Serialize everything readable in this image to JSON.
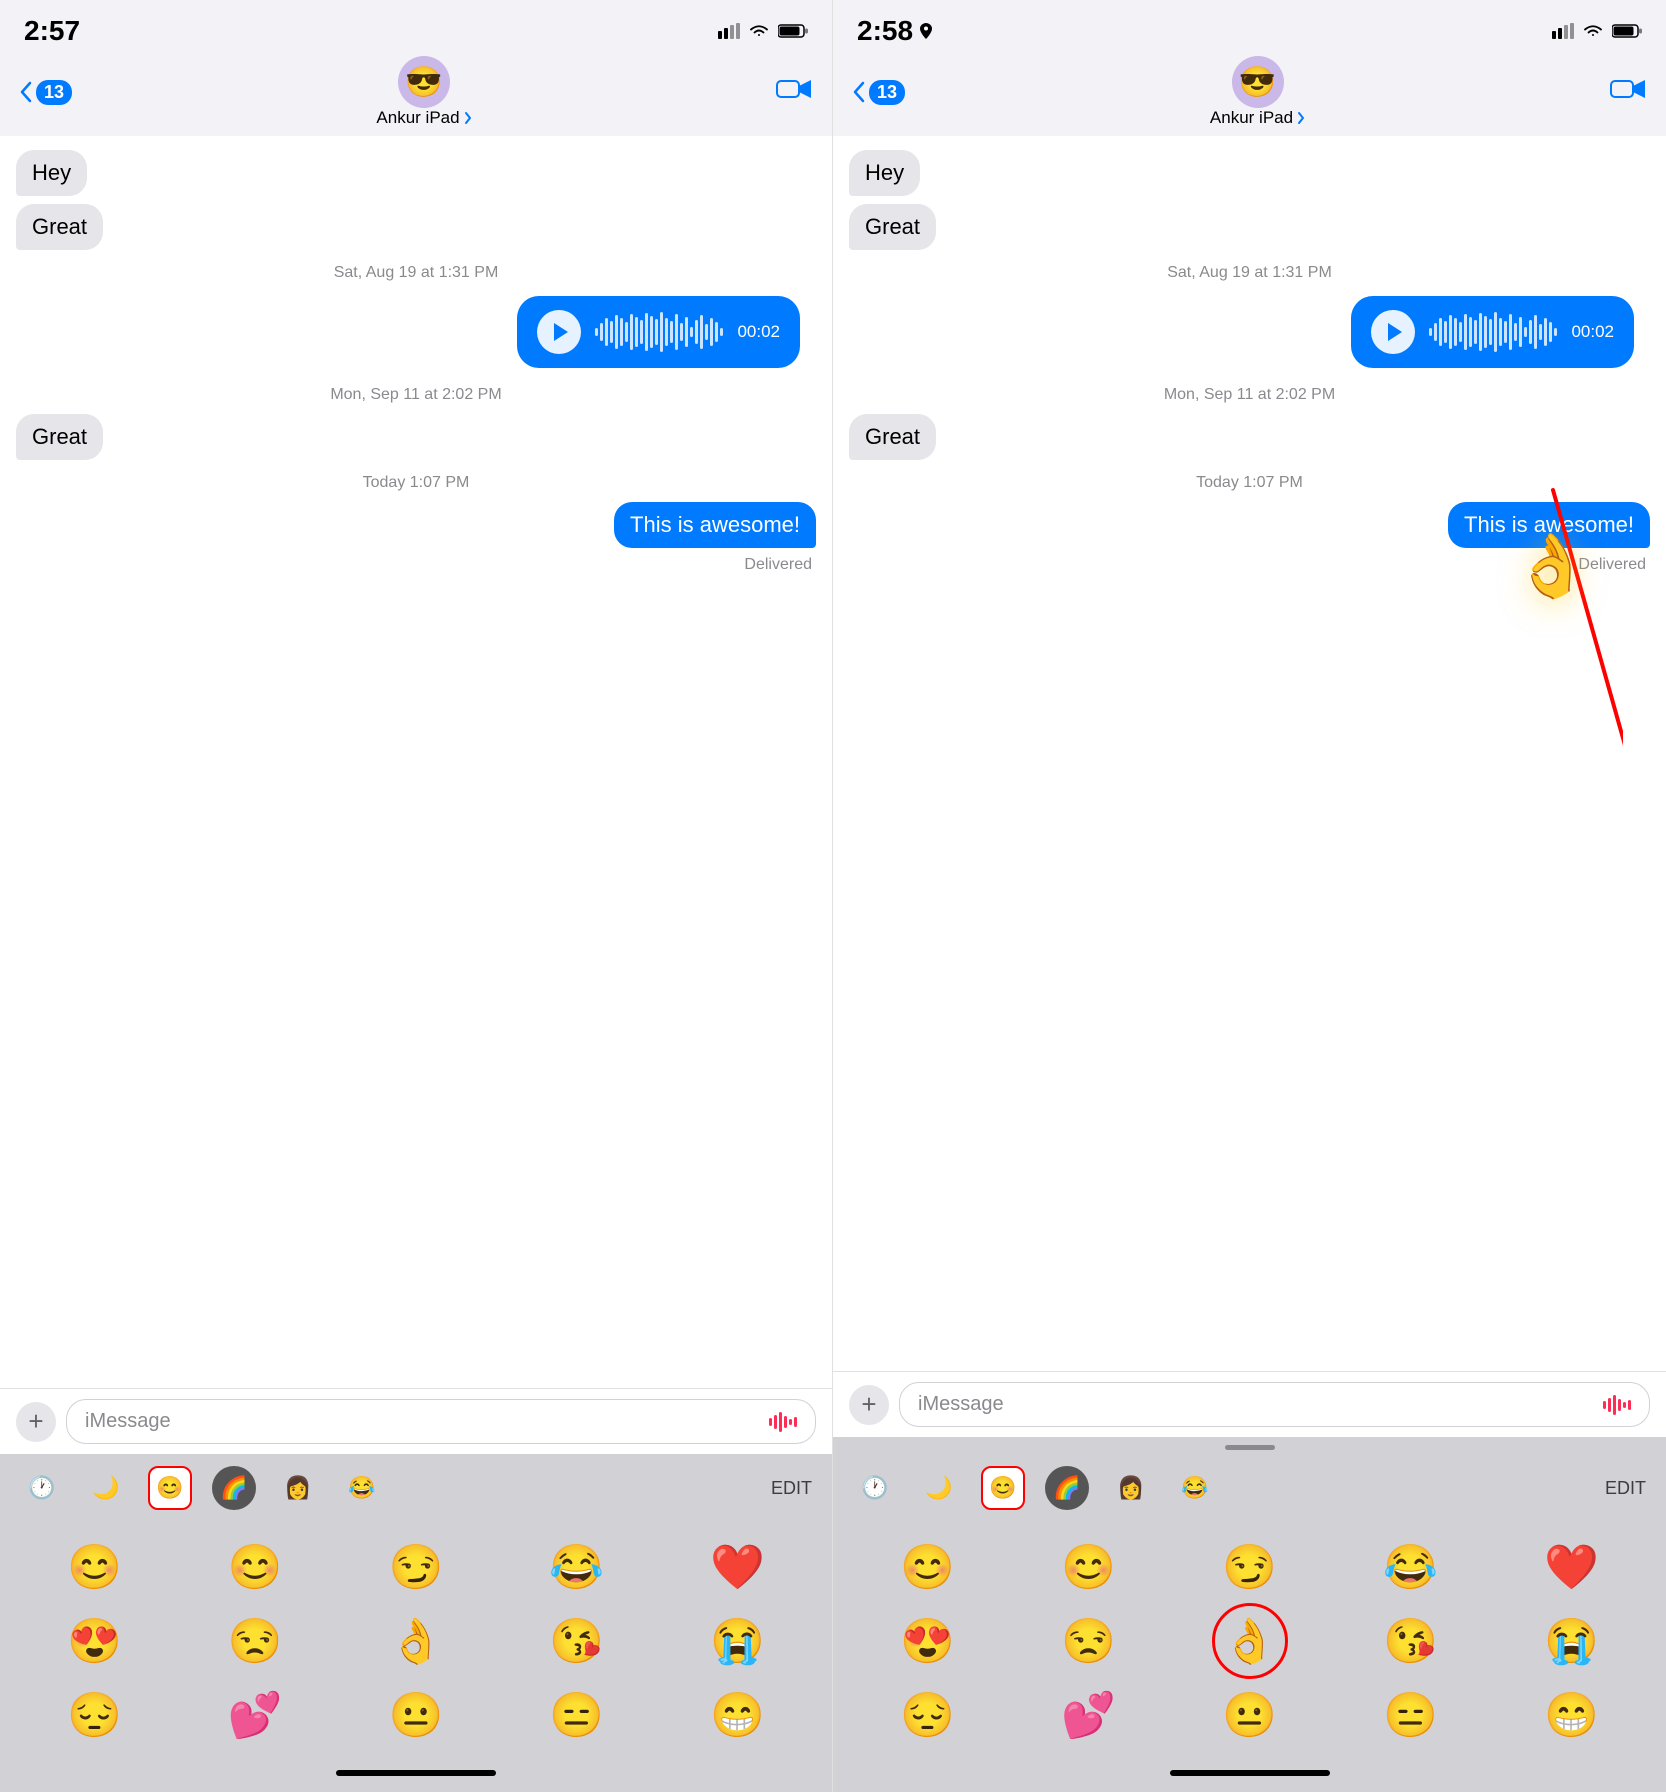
{
  "left_panel": {
    "status": {
      "time": "2:57",
      "signal": "▪▪▪",
      "wifi": "wifi",
      "battery": "battery"
    },
    "nav": {
      "back_count": "13",
      "contact_name": "Ankur iPad",
      "chevron": "›",
      "avatar_emoji": "😎"
    },
    "messages": [
      {
        "type": "left",
        "text": "Hey"
      },
      {
        "type": "left",
        "text": "Great"
      },
      {
        "type": "timestamp",
        "text": "Sat, Aug 19 at 1:31 PM"
      },
      {
        "type": "audio",
        "duration": "00:02"
      },
      {
        "type": "timestamp",
        "text": "Mon, Sep 11 at 2:02 PM"
      },
      {
        "type": "left",
        "text": "Great"
      },
      {
        "type": "timestamp",
        "text": "Today 1:07 PM"
      },
      {
        "type": "right",
        "text": "This is awesome!"
      },
      {
        "type": "delivered",
        "text": "Delivered"
      }
    ],
    "input": {
      "placeholder": "iMessage",
      "plus": "+",
      "waveform": "📊"
    },
    "emoji_tabs": [
      {
        "icon": "🕐",
        "selected": false,
        "label": "recent"
      },
      {
        "icon": "🌙",
        "selected": false,
        "label": "crescent"
      },
      {
        "icon": "😊",
        "selected": true,
        "label": "smiley"
      },
      {
        "icon": "🌈",
        "selected": false,
        "dark": true,
        "label": "colorball"
      },
      {
        "icon": "👩",
        "selected": false,
        "label": "person"
      },
      {
        "icon": "😂",
        "selected": false,
        "label": "laughcry"
      },
      {
        "label_text": "EDIT"
      }
    ],
    "emoji_rows": [
      [
        "😊",
        "😊",
        "😏",
        "😂",
        "❤️"
      ],
      [
        "😍",
        "😒",
        "👌",
        "😘",
        "😭"
      ],
      [
        "😔",
        "💕",
        "😐",
        "😑",
        "😁"
      ]
    ]
  },
  "right_panel": {
    "status": {
      "time": "2:58",
      "location": "▶",
      "signal": "▪▪▪",
      "wifi": "wifi",
      "battery": "battery"
    },
    "nav": {
      "back_count": "13",
      "contact_name": "Ankur iPad",
      "chevron": "›",
      "avatar_emoji": "😎"
    },
    "messages": [
      {
        "type": "left",
        "text": "Hey"
      },
      {
        "type": "left",
        "text": "Great"
      },
      {
        "type": "timestamp",
        "text": "Sat, Aug 19 at 1:31 PM"
      },
      {
        "type": "audio",
        "duration": "00:02"
      },
      {
        "type": "timestamp",
        "text": "Mon, Sep 11 at 2:02 PM"
      },
      {
        "type": "left",
        "text": "Great"
      },
      {
        "type": "timestamp",
        "text": "Today 1:07 PM"
      },
      {
        "type": "right",
        "text": "This is awesome!"
      },
      {
        "type": "delivered",
        "text": "Delivered"
      }
    ],
    "input": {
      "placeholder": "iMessage",
      "plus": "+",
      "waveform": "📊"
    },
    "annotation": {
      "floating_emoji": "👌",
      "arrow_color": "#ff0000",
      "circle_target": "ok-emoji"
    },
    "emoji_tabs": [
      {
        "icon": "🕐",
        "selected": false,
        "label": "recent"
      },
      {
        "icon": "🌙",
        "selected": false,
        "label": "crescent"
      },
      {
        "icon": "😊",
        "selected": true,
        "label": "smiley"
      },
      {
        "icon": "🌈",
        "selected": false,
        "dark": true,
        "label": "colorball"
      },
      {
        "icon": "👩",
        "selected": false,
        "label": "person"
      },
      {
        "icon": "😂",
        "selected": false,
        "label": "laughcry"
      },
      {
        "label_text": "EDIT"
      }
    ],
    "emoji_rows": [
      [
        "😊",
        "😊",
        "😏",
        "😂",
        "❤️"
      ],
      [
        "😍",
        "😒",
        "👌",
        "😘",
        "😭"
      ],
      [
        "😔",
        "💕",
        "😐",
        "😑",
        "😁"
      ]
    ]
  }
}
